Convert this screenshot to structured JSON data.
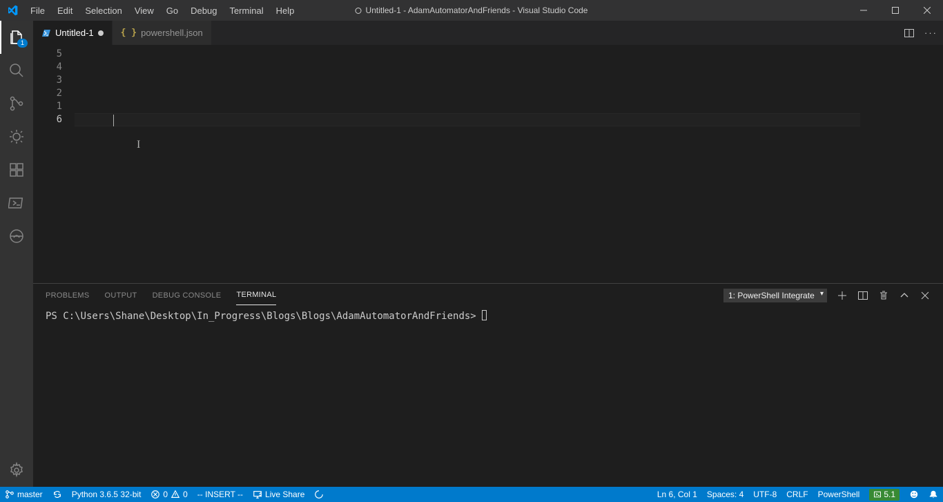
{
  "menu": [
    "File",
    "Edit",
    "Selection",
    "View",
    "Go",
    "Debug",
    "Terminal",
    "Help"
  ],
  "window_title": "Untitled-1 - AdamAutomatorAndFriends - Visual Studio Code",
  "activity_badge": "1",
  "tabs": [
    {
      "label": "Untitled-1",
      "dirty": true,
      "active": true
    },
    {
      "label": "powershell.json",
      "dirty": false,
      "active": false
    }
  ],
  "gutter_lines": [
    "5",
    "4",
    "3",
    "2",
    "1",
    "6"
  ],
  "current_line_index": 5,
  "panel_tabs": [
    "PROBLEMS",
    "OUTPUT",
    "DEBUG CONSOLE",
    "TERMINAL"
  ],
  "panel_active_tab": "TERMINAL",
  "terminal_selector": "1: PowerShell Integrate",
  "terminal_prompt": "PS C:\\Users\\Shane\\Desktop\\In_Progress\\Blogs\\Blogs\\AdamAutomatorAndFriends> ",
  "statusbar": {
    "branch": "master",
    "python": "Python 3.6.5 32-bit",
    "errors": "0",
    "warnings": "0",
    "mode": "-- INSERT --",
    "live_share": "Live Share",
    "ln_col": "Ln 6, Col 1",
    "spaces": "Spaces: 4",
    "encoding": "UTF-8",
    "eol": "CRLF",
    "lang": "PowerShell",
    "ps_ver": "5.1"
  }
}
